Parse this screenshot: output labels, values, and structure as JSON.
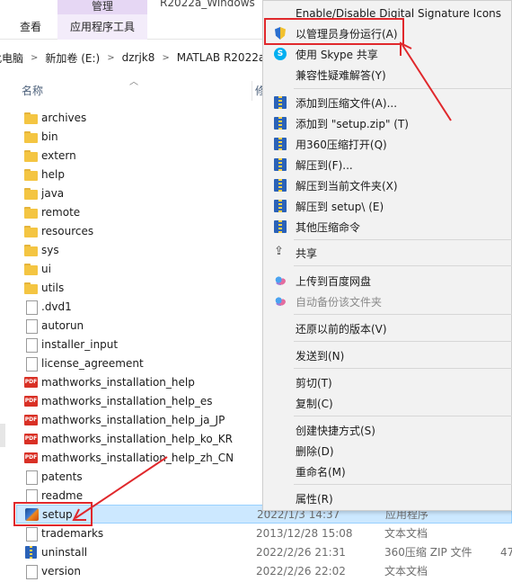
{
  "ribbon": {
    "context_group": "管理",
    "tab_view": "查看",
    "tab_app_tools": "应用程序工具",
    "window_title": "R2022a_Windows"
  },
  "address": {
    "segments": [
      "此电脑",
      "新加卷 (E:)",
      "dzrjk8",
      "MATLAB R2022a"
    ]
  },
  "columns": {
    "name": "名称",
    "modified_partial": "修"
  },
  "files": [
    {
      "name": "archives",
      "icon": "folder-icon",
      "date": "",
      "type": "",
      "size": ""
    },
    {
      "name": "bin",
      "icon": "folder-icon",
      "date": "",
      "type": "",
      "size": ""
    },
    {
      "name": "extern",
      "icon": "folder-icon",
      "date": "",
      "type": "",
      "size": ""
    },
    {
      "name": "help",
      "icon": "folder-icon",
      "date": "",
      "type": "",
      "size": ""
    },
    {
      "name": "java",
      "icon": "folder-icon",
      "date": "",
      "type": "",
      "size": ""
    },
    {
      "name": "remote",
      "icon": "folder-icon",
      "date": "",
      "type": "",
      "size": ""
    },
    {
      "name": "resources",
      "icon": "folder-icon",
      "date": "",
      "type": "",
      "size": ""
    },
    {
      "name": "sys",
      "icon": "folder-icon",
      "date": "",
      "type": "",
      "size": ""
    },
    {
      "name": "ui",
      "icon": "folder-icon",
      "date": "",
      "type": "",
      "size": ""
    },
    {
      "name": "utils",
      "icon": "folder-icon",
      "date": "",
      "type": "",
      "size": ""
    },
    {
      "name": ".dvd1",
      "icon": "file-icon",
      "date": "",
      "type": "",
      "size": ""
    },
    {
      "name": "autorun",
      "icon": "file-icon",
      "date": "",
      "type": "",
      "size": ""
    },
    {
      "name": "installer_input",
      "icon": "file-icon",
      "date": "",
      "type": "",
      "size": ""
    },
    {
      "name": "license_agreement",
      "icon": "file-icon",
      "date": "",
      "type": "",
      "size": ""
    },
    {
      "name": "mathworks_installation_help",
      "icon": "pdf-icon",
      "date": "",
      "type": "",
      "size": ""
    },
    {
      "name": "mathworks_installation_help_es",
      "icon": "pdf-icon",
      "date": "",
      "type": "",
      "size": ""
    },
    {
      "name": "mathworks_installation_help_ja_JP",
      "icon": "pdf-icon",
      "date": "",
      "type": "",
      "size": ""
    },
    {
      "name": "mathworks_installation_help_ko_KR",
      "icon": "pdf-icon",
      "date": "",
      "type": "",
      "size": ""
    },
    {
      "name": "mathworks_installation_help_zh_CN",
      "icon": "pdf-icon",
      "date": "",
      "type": "",
      "size": ""
    },
    {
      "name": "patents",
      "icon": "file-icon",
      "date": "",
      "type": "",
      "size": ""
    },
    {
      "name": "readme",
      "icon": "file-icon",
      "date": "",
      "type": "",
      "size": ""
    },
    {
      "name": "setup",
      "icon": "matlab-setup-icon",
      "date": "2022/1/3 14:37",
      "type": "应用程序",
      "size": "",
      "selected": true
    },
    {
      "name": "trademarks",
      "icon": "file-icon",
      "date": "2013/12/28 15:08",
      "type": "文本文档",
      "size": ""
    },
    {
      "name": "uninstall",
      "icon": "zip-icon",
      "date": "2022/2/26 21:31",
      "type": "360压缩 ZIP 文件",
      "size": "47"
    },
    {
      "name": "version",
      "icon": "file-icon",
      "date": "2022/2/26 22:02",
      "type": "文本文档",
      "size": ""
    }
  ],
  "context_menu": {
    "items": [
      {
        "label": "Enable/Disable Digital Signature Icons",
        "icon": "",
        "disabled": false
      },
      {
        "label": "以管理员身份运行(A)",
        "icon": "uac-shield-icon",
        "disabled": false,
        "highlighted": true
      },
      {
        "label": "使用 Skype 共享",
        "icon": "skype-icon",
        "disabled": false
      },
      {
        "label": "兼容性疑难解答(Y)",
        "icon": "",
        "disabled": false
      },
      {
        "label": "添加到压缩文件(A)...",
        "icon": "zip-icon",
        "disabled": false
      },
      {
        "label": "添加到 \"setup.zip\" (T)",
        "icon": "zip-icon",
        "disabled": false
      },
      {
        "label": "用360压缩打开(Q)",
        "icon": "zip-icon",
        "disabled": false
      },
      {
        "label": "解压到(F)...",
        "icon": "zip-icon",
        "disabled": false
      },
      {
        "label": "解压到当前文件夹(X)",
        "icon": "zip-icon",
        "disabled": false
      },
      {
        "label": "解压到 setup\\ (E)",
        "icon": "zip-icon",
        "disabled": false
      },
      {
        "label": "其他压缩命令",
        "icon": "zip-icon",
        "disabled": false
      },
      {
        "label": "共享",
        "icon": "share-icon",
        "disabled": false
      },
      {
        "label": "上传到百度网盘",
        "icon": "baidu-cloud-icon",
        "disabled": false
      },
      {
        "label": "自动备份该文件夹",
        "icon": "baidu-cloud-icon",
        "disabled": true
      },
      {
        "label": "还原以前的版本(V)",
        "icon": "",
        "disabled": false
      },
      {
        "label": "发送到(N)",
        "icon": "",
        "disabled": false
      },
      {
        "label": "剪切(T)",
        "icon": "",
        "disabled": false
      },
      {
        "label": "复制(C)",
        "icon": "",
        "disabled": false
      },
      {
        "label": "创建快捷方式(S)",
        "icon": "",
        "disabled": false
      },
      {
        "label": "删除(D)",
        "icon": "",
        "disabled": false
      },
      {
        "label": "重命名(M)",
        "icon": "",
        "disabled": false
      },
      {
        "label": "属性(R)",
        "icon": "",
        "disabled": false
      }
    ]
  },
  "colors": {
    "annotation_red": "#e0282c",
    "selection_bg": "#cce8ff",
    "selection_border": "#99d1ff",
    "menu_bg": "#f2f2f2",
    "folder_yellow": "#f4c542"
  }
}
